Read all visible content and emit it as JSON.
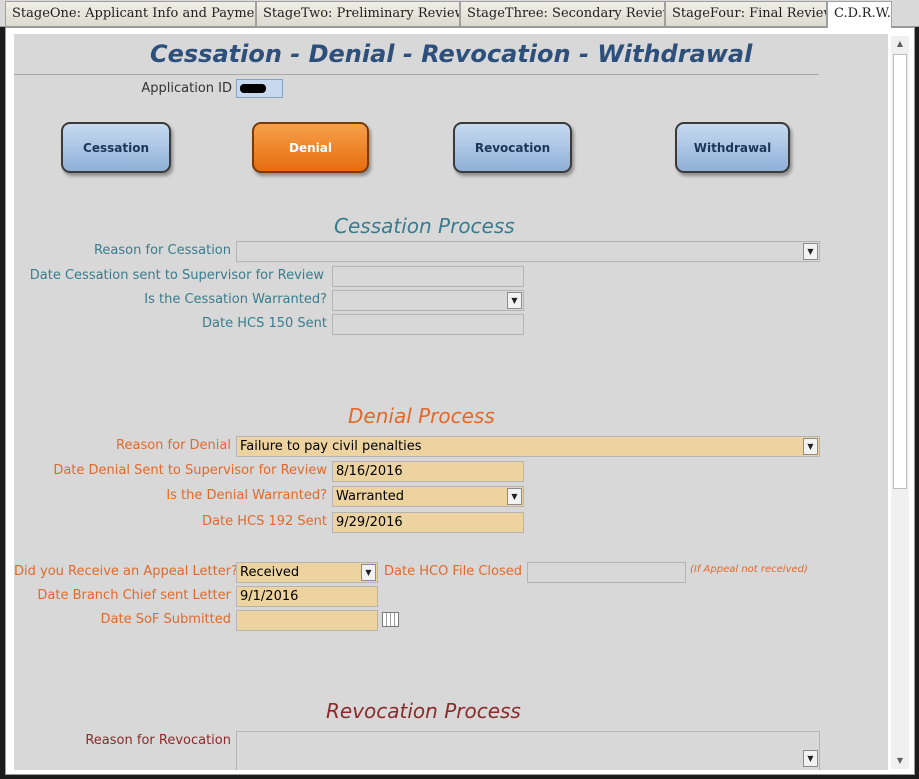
{
  "tabs": [
    {
      "label": "StageOne: Applicant Info and Payment"
    },
    {
      "label": "StageTwo: Preliminary Review"
    },
    {
      "label": "StageThree: Secondary Review"
    },
    {
      "label": "StageFour: Final Review"
    },
    {
      "label": "C.D.R.W."
    }
  ],
  "active_tab": "C.D.R.W.",
  "form": {
    "title": "Cessation - Denial - Revocation - Withdrawal",
    "application_id_label": "Application ID",
    "application_id_value": "",
    "buttons": {
      "cessation": "Cessation",
      "denial": "Denial",
      "revocation": "Revocation",
      "withdrawal": "Withdrawal"
    },
    "active_button": "Denial"
  },
  "cessation": {
    "heading": "Cessation Process",
    "reason_label": "Reason for Cessation",
    "reason_value": "",
    "date_sent_label": "Date Cessation sent to Supervisor for Review",
    "date_sent_value": "",
    "warranted_label": "Is the Cessation Warranted?",
    "warranted_value": "",
    "hcs_label": "Date HCS 150 Sent",
    "hcs_value": ""
  },
  "denial": {
    "heading": "Denial Process",
    "reason_label": "Reason for Denial",
    "reason_value": "Failure to pay civil penalties",
    "date_sent_label": "Date Denial Sent to Supervisor for Review",
    "date_sent_value": "8/16/2016",
    "warranted_label": "Is the Denial Warranted?",
    "warranted_value": "Warranted",
    "hcs_label": "Date HCS 192 Sent",
    "hcs_value": "9/29/2016",
    "appeal_label": "Did you Receive an Appeal Letter?",
    "appeal_value": "Received",
    "hco_closed_label": "Date HCO File Closed",
    "hco_closed_value": "",
    "hco_note": "(If Appeal not received)",
    "branch_chief_label": "Date Branch Chief sent Letter",
    "branch_chief_value": "9/1/2016",
    "sof_label": "Date SoF Submitted",
    "sof_value": ""
  },
  "revocation": {
    "heading": "Revocation Process",
    "reason_label": "Reason for Revocation",
    "reason_value": ""
  },
  "colors": {
    "title": "#2c4f7c",
    "cessation": "#3a7c8e",
    "denial": "#e2692b",
    "revocation": "#8b2a2a",
    "filled_field": "#ecd3a0",
    "active_button": "#e66d0f"
  },
  "icons": [
    "dropdown-arrow-icon",
    "calendar-icon",
    "scroll-up-icon",
    "scroll-down-icon"
  ]
}
